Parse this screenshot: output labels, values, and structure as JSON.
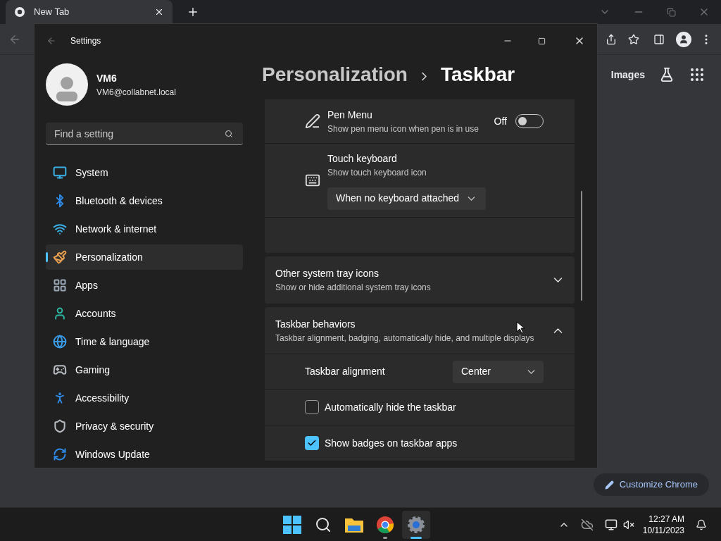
{
  "browser": {
    "tab": {
      "title": "New Tab"
    },
    "links": [
      {
        "label": "Images"
      }
    ],
    "customize_button": {
      "label": "Customize Chrome"
    }
  },
  "settings": {
    "title": "Settings",
    "user": {
      "name": "VM6",
      "email": "VM6@collabnet.local"
    },
    "search": {
      "placeholder": "Find a setting"
    },
    "nav": [
      {
        "label": "System",
        "selected": false
      },
      {
        "label": "Bluetooth & devices",
        "selected": false
      },
      {
        "label": "Network & internet",
        "selected": false
      },
      {
        "label": "Personalization",
        "selected": true
      },
      {
        "label": "Apps",
        "selected": false
      },
      {
        "label": "Accounts",
        "selected": false
      },
      {
        "label": "Time & language",
        "selected": false
      },
      {
        "label": "Gaming",
        "selected": false
      },
      {
        "label": "Accessibility",
        "selected": false
      },
      {
        "label": "Privacy & security",
        "selected": false
      },
      {
        "label": "Windows Update",
        "selected": false
      }
    ],
    "breadcrumb": {
      "parent": "Personalization",
      "current": "Taskbar"
    },
    "pen_items": [
      {
        "kind": "toggle",
        "title": "Pen Menu",
        "description": "Show pen menu icon when pen is in use",
        "state_label": "Off",
        "on": false
      },
      {
        "kind": "dropdown",
        "title": "Touch keyboard",
        "description": "Show touch keyboard icon",
        "value": "When no keyboard attached"
      }
    ],
    "sections": [
      {
        "title": "Other system tray icons",
        "description": "Show or hide additional system tray icons",
        "expanded": false
      },
      {
        "title": "Taskbar behaviors",
        "description": "Taskbar alignment, badging, automatically hide, and multiple displays",
        "expanded": true,
        "rows": [
          {
            "kind": "dropdown",
            "label": "Taskbar alignment",
            "value": "Center"
          },
          {
            "kind": "checkbox",
            "label": "Automatically hide the taskbar",
            "checked": false
          },
          {
            "kind": "checkbox",
            "label": "Show badges on taskbar apps",
            "checked": true
          }
        ]
      }
    ]
  },
  "taskbar": {
    "apps": [
      {
        "kind": "start",
        "selected": false,
        "running": false
      },
      {
        "kind": "search",
        "selected": false,
        "running": false
      },
      {
        "kind": "explorer",
        "selected": false,
        "running": false
      },
      {
        "kind": "chrome",
        "selected": false,
        "running": true
      },
      {
        "kind": "settings",
        "selected": true,
        "running": true
      }
    ],
    "time": "12:27 AM",
    "date": "10/11/2023"
  }
}
